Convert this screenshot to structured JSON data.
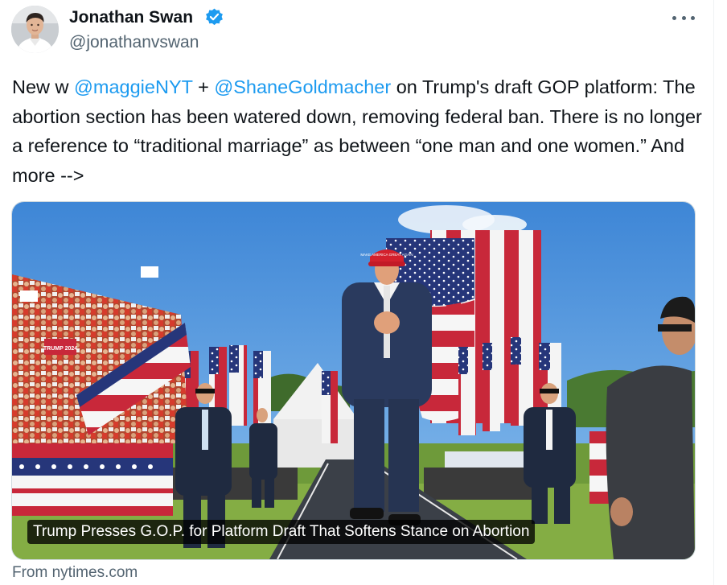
{
  "author": {
    "name": "Jonathan Swan",
    "handle": "@jonathanvswan",
    "verified": true,
    "avatar_icon": "profile-photo"
  },
  "more_icon": "more-dots-icon",
  "tweet": {
    "part1": "New w ",
    "mention1": "@maggieNYT",
    "part2": " + ",
    "mention2": "@ShaneGoldmacher",
    "part3": " on Trump's draft GOP platform: The abortion section has been watered down, removing federal ban. There is no longer a reference to “traditional marriage” as between “one man and one women.” And more -->"
  },
  "link_card": {
    "caption": "Trump Presses G.O.P. for Platform Draft That Softens Stance on Abortion",
    "source": "From nytimes.com",
    "hat_text": "MAKE AMERICA GREAT AGAIN",
    "sign_text": "TRUMP 2024"
  },
  "colors": {
    "link": "#1d9bf0",
    "verified": "#1d9bf0",
    "secondary_text": "#536471",
    "sky": "#5f9fe0",
    "grass": "#6e9a3a",
    "suit": "#2a3a5e"
  }
}
